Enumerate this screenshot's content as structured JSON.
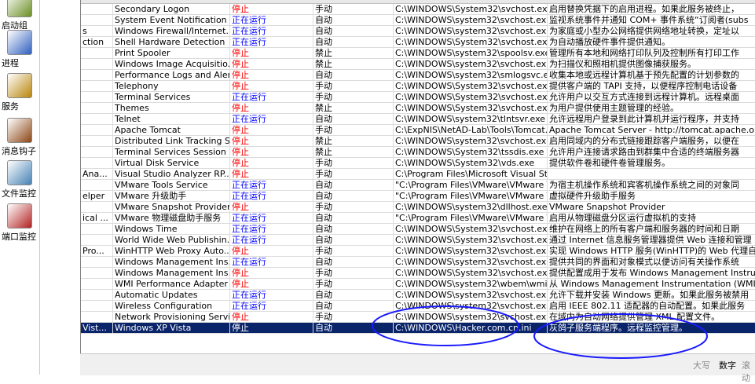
{
  "sidebar": [
    {
      "label": "启动组",
      "icon": "startup-group-icon"
    },
    {
      "label": "进程",
      "icon": "process-icon"
    },
    {
      "label": "服务",
      "icon": "services-gear-icon"
    },
    {
      "label": "消息钩子",
      "icon": "message-hook-icon"
    },
    {
      "label": "文件监控",
      "icon": "file-monitor-icon"
    },
    {
      "label": "端口监控",
      "icon": "port-monitor-icon"
    }
  ],
  "rows": [
    {
      "c0": "",
      "name": "Secondary Logon",
      "status": "停止",
      "startup": "手动",
      "path": "C:\\WINDOWS\\System32\\svchost.ex...",
      "desc": "启用替换凭据下的启用进程。如果此服务被终止，"
    },
    {
      "c0": "",
      "name": "System Event Notification",
      "status": "正在运行",
      "startup": "自动",
      "path": "C:\\WINDOWS\\system32\\svchost.ex...",
      "desc": "监视系统事件并通知 COM+ 事件系统“订阅者(subs"
    },
    {
      "c0": "s",
      "name": "Windows Firewall/Internet...",
      "status": "正在运行",
      "startup": "自动",
      "path": "C:\\WINDOWS\\system32\\svchost.ex...",
      "desc": "为家庭或小型办公网络提供网络地址转换，定址以"
    },
    {
      "c0": "ction",
      "name": "Shell Hardware Detection",
      "status": "正在运行",
      "startup": "自动",
      "path": "C:\\WINDOWS\\System32\\svchost.ex...",
      "desc": "为自动播放硬件事件提供通知。"
    },
    {
      "c0": "",
      "name": "Print Spooler",
      "status": "停止",
      "startup": "禁止",
      "path": "C:\\WINDOWS\\system32\\spoolsv.exe",
      "desc": "管理所有本地和网络打印队列及控制所有打印工作"
    },
    {
      "c0": "",
      "name": "Windows Image Acquisitio...",
      "status": "停止",
      "startup": "禁止",
      "path": "C:\\WINDOWS\\system32\\svchost.ex...",
      "desc": "为扫描仪和照相机提供图像捕获服务。"
    },
    {
      "c0": "",
      "name": "Performance Logs and Alerts",
      "status": "停止",
      "startup": "自动",
      "path": "C:\\WINDOWS\\system32\\smlogsvc.exe",
      "desc": "收集本地或远程计算机基于预先配置的计划参数的"
    },
    {
      "c0": "",
      "name": "Telephony",
      "status": "停止",
      "startup": "手动",
      "path": "C:\\WINDOWS\\System32\\svchost.ex...",
      "desc": "提供客户端的 TAPI 支持，以便程序控制电话设备"
    },
    {
      "c0": "",
      "name": "Terminal Services",
      "status": "正在运行",
      "startup": "手动",
      "path": "C:\\WINDOWS\\System32\\svchost.ex...",
      "desc": "允许用户以交互方式连接到远程计算机。远程桌面"
    },
    {
      "c0": "",
      "name": "Themes",
      "status": "停止",
      "startup": "禁止",
      "path": "C:\\WINDOWS\\System32\\svchost.ex...",
      "desc": "为用户提供使用主题管理的经验。"
    },
    {
      "c0": "",
      "name": "Telnet",
      "status": "正在运行",
      "startup": "自动",
      "path": "C:\\WINDOWS\\system32\\tlntsvr.exe",
      "desc": "允许远程用户登录到此计算机并运行程序，并支持"
    },
    {
      "c0": "",
      "name": "Apache Tomcat",
      "status": "停止",
      "startup": "手动",
      "path": "C:\\ExpNIS\\NetAD-Lab\\Tools\\Tomcat...",
      "desc": "Apache Tomcat Server - http://tomcat.apache.org"
    },
    {
      "c0": "",
      "name": "Distributed Link Tracking S...",
      "status": "停止",
      "startup": "禁止",
      "path": "C:\\WINDOWS\\system32\\svchost.ex...",
      "desc": "启用同域内的分布式链接跟踪客户端服务，以便在"
    },
    {
      "c0": "",
      "name": "Terminal Services Session ...",
      "status": "停止",
      "startup": "禁止",
      "path": "C:\\WINDOWS\\System32\\tssdis.exe",
      "desc": "允许用户连接请求路由到群集中合适的终端服务器"
    },
    {
      "c0": "",
      "name": "Virtual Disk Service",
      "status": "停止",
      "startup": "手动",
      "path": "C:\\WINDOWS\\System32\\vds.exe",
      "desc": "提供软件卷和硬件卷管理服务。"
    },
    {
      "c0": "Ana...",
      "name": "Visual Studio Analyzer RP...",
      "status": "停止",
      "startup": "手动",
      "path": "C:\\Program Files\\Microsoft Visual Stu...",
      "desc": ""
    },
    {
      "c0": "",
      "name": "VMware Tools Service",
      "status": "正在运行",
      "startup": "自动",
      "path": "\"C:\\Program Files\\VMware\\VMware T...",
      "desc": "为宿主机操作系统和宾客机操作系统之间的对象同"
    },
    {
      "c0": "elper",
      "name": "VMware 升级助手",
      "status": "正在运行",
      "startup": "自动",
      "path": "\"C:\\Program Files\\VMware\\VMware T...",
      "desc": "虚拟硬件升级助手服务"
    },
    {
      "c0": "",
      "name": "VMware Snapshot Provider",
      "status": "停止",
      "startup": "手动",
      "path": "C:\\WINDOWS\\system32\\dllhost.exe...",
      "desc": "VMware Snapshot Provider"
    },
    {
      "c0": "ical ...",
      "name": "VMware 物理磁盘助手服务",
      "status": "正在运行",
      "startup": "自动",
      "path": "\"C:\\Program Files\\VMware\\VMware T...",
      "desc": "启用从物理磁盘分区运行虚拟机的支持"
    },
    {
      "c0": "",
      "name": "Windows Time",
      "status": "正在运行",
      "startup": "自动",
      "path": "C:\\WINDOWS\\System32\\svchost.ex...",
      "desc": "维护在网络上的所有客户端和服务器的时间和日期"
    },
    {
      "c0": "",
      "name": "World Wide Web Publishin...",
      "status": "正在运行",
      "startup": "自动",
      "path": "C:\\WINDOWS\\System32\\svchost.ex...",
      "desc": "通过 Internet 信息服务管理器提供 Web 连接和管理"
    },
    {
      "c0": "Pro...",
      "name": "WinHTTP Web Proxy Auto...",
      "status": "停止",
      "startup": "手动",
      "path": "C:\\WINDOWS\\system32\\svchost.ex...",
      "desc": "实现 Windows HTTP 服务(WinHTTP)的 Web 代理自动"
    },
    {
      "c0": "",
      "name": "Windows Management Ins...",
      "status": "正在运行",
      "startup": "自动",
      "path": "C:\\WINDOWS\\system32\\svchost.ex...",
      "desc": "提供共同的界面和对象模式以便访问有关操作系统"
    },
    {
      "c0": "",
      "name": "Windows Management Ins...",
      "status": "停止",
      "startup": "手动",
      "path": "C:\\WINDOWS\\System32\\svchost.ex...",
      "desc": "提供配置成用于发布 Windows Management Instrum"
    },
    {
      "c0": "",
      "name": "WMI Performance Adapter",
      "status": "停止",
      "startup": "手动",
      "path": "C:\\WINDOWS\\system32\\wbem\\wmi...",
      "desc": "从 Windows Management Instrumentation (WMI) 提供"
    },
    {
      "c0": "",
      "name": "Automatic Updates",
      "status": "正在运行",
      "startup": "自动",
      "path": "C:\\WINDOWS\\system32\\svchost.ex...",
      "desc": "允许下载并安装 Windows 更新。如果此服务被禁用"
    },
    {
      "c0": "",
      "name": "Wireless Configuration",
      "status": "正在运行",
      "startup": "自动",
      "path": "C:\\WINDOWS\\system32\\svchost.ex...",
      "desc": "启用 IEEE 802.11 适配器的自动配置。如果此服务"
    },
    {
      "c0": "",
      "name": "Network Provisioning Service",
      "status": "停止",
      "startup": "手动",
      "path": "C:\\WINDOWS\\system32\\svchost.ex...",
      "desc": "在域内为自动网络提供管理 XML 配置文件。"
    },
    {
      "c0": "Vist...",
      "name": "Windows XP Vista",
      "status": "停止",
      "startup": "自动",
      "path": "C:\\WINDOWS\\Hacker.com.cn.ini",
      "desc": "灰鸽子服务端程序。远程监控管理。",
      "selected": true
    }
  ],
  "status_bar": {
    "caps": "大写",
    "num": "数字",
    "scroll": "滚动"
  },
  "colors": {
    "running": "#0000ff",
    "stopped": "#ff0000",
    "selection": "#0a246a",
    "annotation": "#1a1aff"
  }
}
